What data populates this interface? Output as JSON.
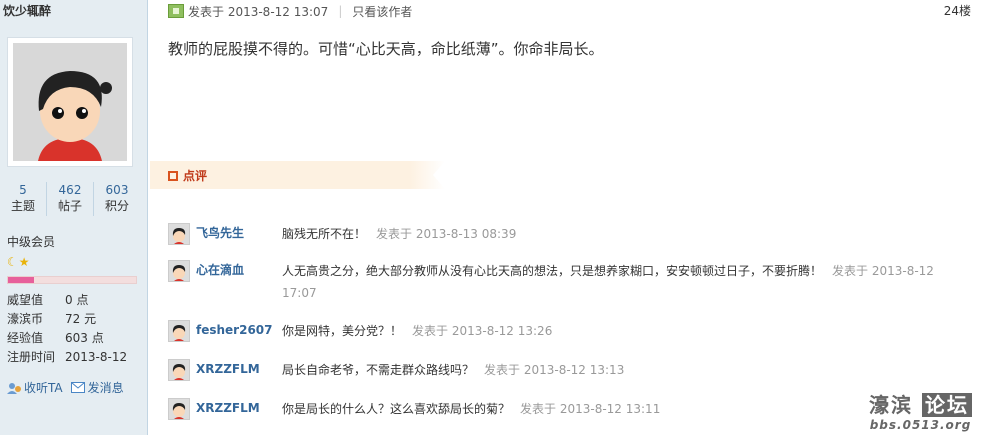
{
  "sidebar": {
    "username": "饮少辄醉",
    "stats": [
      {
        "value": "5",
        "label": "主题"
      },
      {
        "value": "462",
        "label": "帖子"
      },
      {
        "value": "603",
        "label": "积分"
      }
    ],
    "rank": "中级会员",
    "rank_progress": 0.2,
    "profile": [
      {
        "key": "威望值",
        "value": "0 点"
      },
      {
        "key": "濠滨币",
        "value": "72 元"
      },
      {
        "key": "经验值",
        "value": "603 点"
      },
      {
        "key": "注册时间",
        "value": "2013-8-12"
      }
    ],
    "follow_label": "收听TA",
    "message_label": "发消息"
  },
  "post": {
    "posted_at": "发表于 2013-8-12 13:07",
    "only_author": "只看该作者",
    "floor": "24楼",
    "body": "教师的屁股摸不得的。可惜“心比天高，命比纸薄”。你命非局长。"
  },
  "comments_header": "点评",
  "comments": [
    {
      "user": "飞鸟先生",
      "text": "脑残无所不在！",
      "time": "发表于 2013-8-13 08:39"
    },
    {
      "user": "心在滴血",
      "text": "人无高贵之分，绝大部分教师从没有心比天高的想法，只是想养家糊口，安安顿顿过日子，不要折腾！",
      "time": "发表于 2013-8-12 17:07"
    },
    {
      "user": "fesher2607",
      "text": "你是网特，美分党？！",
      "time": "发表于 2013-8-12 13:26"
    },
    {
      "user": "XRZZFLM",
      "text": "局长自命老爷，不需走群众路线吗？",
      "time": "发表于 2013-8-12 13:13"
    },
    {
      "user": "XRZZFLM",
      "text": "你是局长的什么人？这么喜欢舔局长的菊？",
      "time": "发表于 2013-8-12 13:11"
    }
  ],
  "logo": {
    "left": "濠滨",
    "right": "论坛",
    "url": "bbs.0513.org"
  }
}
